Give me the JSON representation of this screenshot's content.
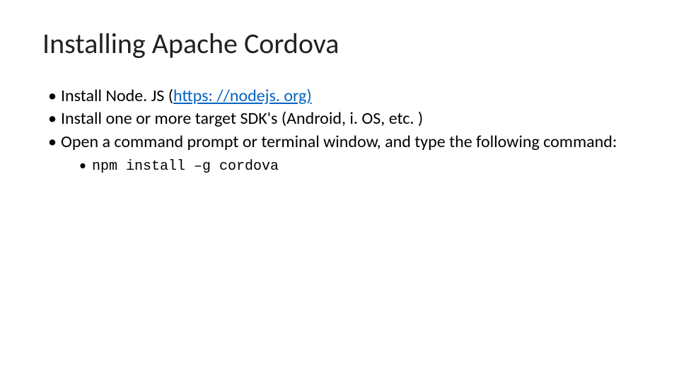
{
  "title": "Installing Apache Cordova",
  "bullets": {
    "b1_pre": "Install Node. JS (",
    "b1_link": "https: //nodejs. org)",
    "b2": "Install one or more target SDK's (Android, i. OS, etc. )",
    "b3": "Open a command prompt or terminal window, and type the following command:",
    "b3_sub": "npm install –g cordova"
  }
}
